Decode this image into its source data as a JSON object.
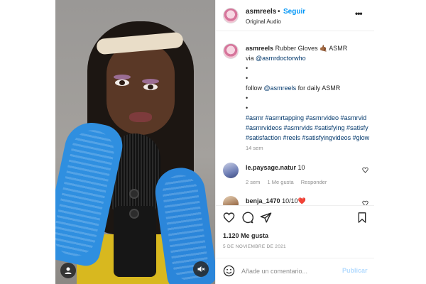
{
  "header": {
    "username": "asmreels",
    "separator": "•",
    "follow_label": "Seguir",
    "audio_label": "Original Audio",
    "more_label": "•••"
  },
  "caption": {
    "username": "asmreels",
    "title": "Rubber Gloves 🤙🏾 ASMR",
    "via_prefix": "via ",
    "via_handle": "@asmrdoctorwho",
    "bullet1": "•",
    "bullet2": "•",
    "follow_prefix": "follow ",
    "follow_handle": "@asmreels",
    "follow_suffix": " for daily ASMR",
    "bullet3": "•",
    "bullet4": "•",
    "hashtags": "#asmr #asmrtapping #asmrvideo #asmrvid #asmrvideos #asmrvids #satisfying #satisfy #satisfaction #reels #satisfyingvideos #glow",
    "time": "14 sem"
  },
  "comments": [
    {
      "username": "le.paysage.natur",
      "text": "10",
      "time": "2 sem",
      "likes": "1 Me gusta",
      "reply_label": "Responder"
    },
    {
      "username": "benja_1470",
      "text": "10/10❤️"
    }
  ],
  "actions": {
    "likes": "1.120 Me gusta",
    "date": "5 DE NOVIEMBRE DE 2021"
  },
  "add_comment": {
    "placeholder": "Añade un comentario...",
    "publish_label": "Publicar"
  },
  "colors": {
    "link": "#00376b",
    "follow": "#0095f6",
    "publish_disabled": "#b3dbff",
    "muted": "#8e8e8e"
  },
  "icons": {
    "like": "heart-icon",
    "comment": "comment-icon",
    "share": "paper-plane-icon",
    "save": "bookmark-icon",
    "emoji": "emoji-icon",
    "tagged_user": "user-icon",
    "mute": "speaker-muted-icon"
  }
}
